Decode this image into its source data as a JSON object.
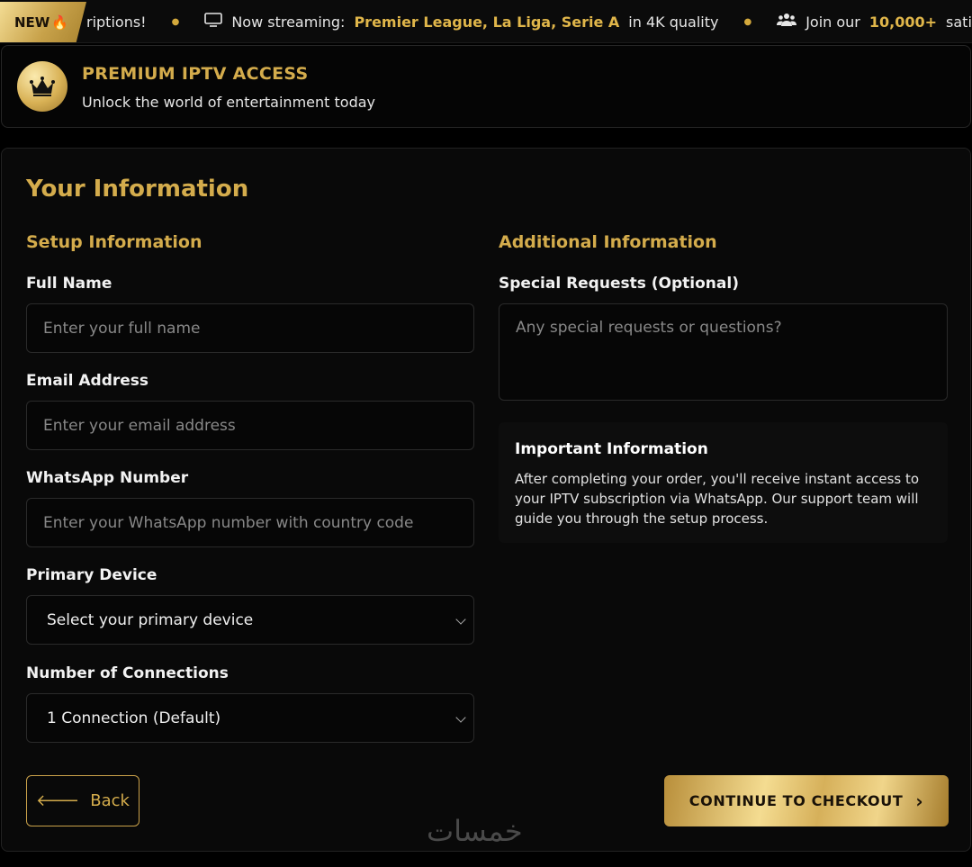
{
  "ticker": {
    "new_badge": "NEW",
    "fire_icon": "🔥",
    "item1": "riptions!",
    "item2_prefix": "Now streaming:",
    "item2_highlight": "Premier League, La Liga, Serie A",
    "item2_suffix": "in 4K quality",
    "item3_prefix": "Join our",
    "item3_highlight": "10,000+",
    "item3_suffix": "satisfied"
  },
  "header": {
    "title": "PREMIUM IPTV ACCESS",
    "subtitle": "Unlock the world of entertainment today",
    "icon": "crown-icon"
  },
  "form": {
    "title": "Your Information",
    "setup_section": "Setup Information",
    "additional_section": "Additional Information",
    "full_name_label": "Full Name",
    "full_name_placeholder": "Enter your full name",
    "email_label": "Email Address",
    "email_placeholder": "Enter your email address",
    "whatsapp_label": "WhatsApp Number",
    "whatsapp_placeholder": "Enter your WhatsApp number with country code",
    "device_label": "Primary Device",
    "device_value": "Select your primary device",
    "connections_label": "Number of Connections",
    "connections_value": "1 Connection (Default)",
    "requests_label": "Special Requests (Optional)",
    "requests_placeholder": "Any special requests or questions?"
  },
  "info": {
    "title": "Important Information",
    "text": "After completing your order, you'll receive instant access to your IPTV subscription via WhatsApp. Our support team will guide you through the setup process."
  },
  "buttons": {
    "back": "Back",
    "checkout": "CONTINUE TO CHECKOUT"
  },
  "watermark": "خمسات",
  "colors": {
    "gold": "#d4ac4c",
    "background": "#000000",
    "card": "#090909"
  }
}
